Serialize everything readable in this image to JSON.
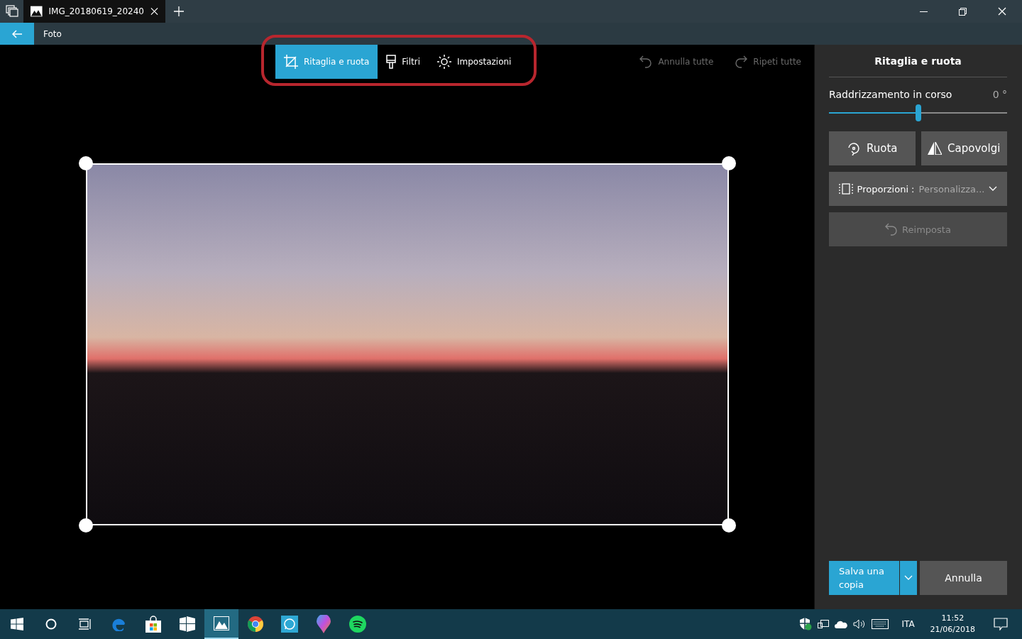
{
  "window": {
    "tab_title": "IMG_20180619_20240"
  },
  "app_bar": {
    "title": "Foto"
  },
  "toolbar": {
    "tools": [
      {
        "kind": "crop",
        "label": "Ritaglia e ruota",
        "selected": true
      },
      {
        "kind": "filter",
        "label": "Filtri",
        "selected": false
      },
      {
        "kind": "adjust",
        "label": "Impostazioni",
        "selected": false
      }
    ],
    "undo": {
      "label": "Annulla tutte",
      "disabled": true
    },
    "redo": {
      "label": "Ripeti tutte",
      "disabled": true
    }
  },
  "panel": {
    "title": "Ritaglia e ruota",
    "straighten": {
      "label": "Raddrizzamento in corso",
      "reading": "0 °",
      "level": 0.5
    },
    "rotate": "Ruota",
    "flip": "Capovolgi",
    "aspect": {
      "label": "Proporzioni :",
      "value": "Personalizza..."
    },
    "reset": {
      "label": "Reimposta",
      "disabled": true
    },
    "save": "Salva una copia",
    "cancel": "Annulla"
  },
  "taskbar": {
    "apps": [
      {
        "kind": "start",
        "selected": false
      },
      {
        "kind": "search",
        "selected": false
      },
      {
        "kind": "taskview",
        "selected": false
      },
      {
        "kind": "browser",
        "selected": false
      },
      {
        "kind": "store",
        "selected": false
      },
      {
        "kind": "office",
        "selected": false
      },
      {
        "kind": "photos",
        "selected": true
      },
      {
        "kind": "chrome",
        "selected": false
      },
      {
        "kind": "chat",
        "selected": false
      },
      {
        "kind": "paint",
        "selected": false
      },
      {
        "kind": "music",
        "selected": false
      }
    ],
    "language": "ITA",
    "time": "11:52",
    "date": "21/06/2018"
  }
}
